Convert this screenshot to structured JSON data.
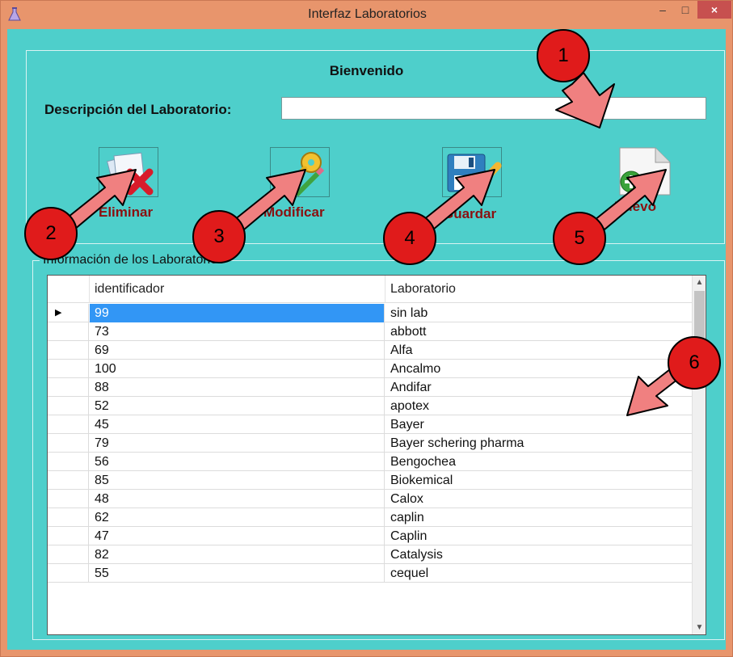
{
  "window": {
    "title": "Interfaz Laboratorios",
    "minimize_glyph": "–",
    "maximize_glyph": "□",
    "close_glyph": "×"
  },
  "form": {
    "welcome": "Bienvenido",
    "description_label": "Descripción del Laboratorio:",
    "description_value": ""
  },
  "actions": [
    {
      "label": "Eliminar",
      "icon": "delete-document-icon"
    },
    {
      "label": "Modificar",
      "icon": "keys-edit-icon"
    },
    {
      "label": "Guardar",
      "icon": "floppy-save-icon"
    },
    {
      "label": "Nuevo",
      "icon": "new-document-icon"
    }
  ],
  "group": {
    "legend": "Información de los Laboratorios"
  },
  "grid": {
    "columns": [
      "identificador",
      "Laboratorio"
    ],
    "selected_row": 0,
    "rows": [
      {
        "id": "99",
        "lab": "sin lab"
      },
      {
        "id": "73",
        "lab": "abbott"
      },
      {
        "id": "69",
        "lab": "Alfa"
      },
      {
        "id": "100",
        "lab": "Ancalmo"
      },
      {
        "id": "88",
        "lab": "Andifar"
      },
      {
        "id": "52",
        "lab": "apotex"
      },
      {
        "id": "45",
        "lab": "Bayer"
      },
      {
        "id": "79",
        "lab": "Bayer schering pharma"
      },
      {
        "id": "56",
        "lab": "Bengochea"
      },
      {
        "id": "85",
        "lab": "Biokemical"
      },
      {
        "id": "48",
        "lab": "Calox"
      },
      {
        "id": "62",
        "lab": "caplin"
      },
      {
        "id": "47",
        "lab": "Caplin"
      },
      {
        "id": "82",
        "lab": "Catalysis"
      },
      {
        "id": "55",
        "lab": "cequel"
      }
    ]
  },
  "callouts": [
    "1",
    "2",
    "3",
    "4",
    "5",
    "6"
  ],
  "colors": {
    "title_bar": "#e8956c",
    "client": "#4ecfcb",
    "selection": "#3296f5",
    "callout_fill": "#e01b1b",
    "arrow_fill": "#f08080",
    "action_label": "#8b1010"
  }
}
